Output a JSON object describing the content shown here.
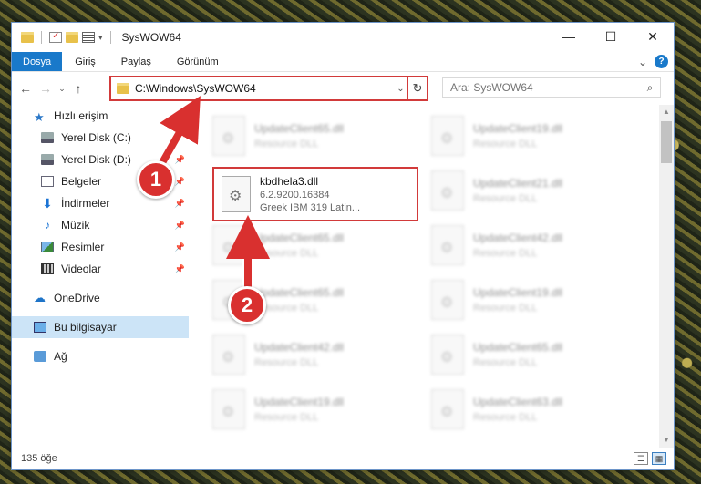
{
  "window": {
    "title": "SysWOW64",
    "controls": {
      "minimize": "—",
      "maximize": "☐",
      "close": "✕"
    }
  },
  "ribbon": {
    "tabs": [
      "Dosya",
      "Giriş",
      "Paylaş",
      "Görünüm"
    ],
    "expand": "⌄",
    "help": "?"
  },
  "nav": {
    "back": "←",
    "forward": "→",
    "recent": "⌄",
    "up": "↑"
  },
  "address": {
    "path": "C:\\Windows\\SysWOW64",
    "dropdown": "⌄",
    "refresh": "↻"
  },
  "search": {
    "placeholder": "Ara: SysWOW64",
    "icon": "search-icon"
  },
  "sidebar": {
    "quick_access": "Hızlı erişim",
    "items": [
      {
        "label": "Yerel Disk (C:)",
        "icon": "disk-icon",
        "pinned": true
      },
      {
        "label": "Yerel Disk (D:)",
        "icon": "disk-icon",
        "pinned": true
      },
      {
        "label": "Belgeler",
        "icon": "document-icon",
        "pinned": true
      },
      {
        "label": "İndirmeler",
        "icon": "download-icon",
        "pinned": true
      },
      {
        "label": "Müzik",
        "icon": "music-icon",
        "pinned": true
      },
      {
        "label": "Resimler",
        "icon": "pictures-icon",
        "pinned": true
      },
      {
        "label": "Videolar",
        "icon": "videos-icon",
        "pinned": true
      }
    ],
    "onedrive": "OneDrive",
    "this_pc": "Bu bilgisayar",
    "network": "Ağ"
  },
  "files": {
    "blurred": [
      {
        "name": "UpdateClient65.dll",
        "desc": "Resource DLL"
      },
      {
        "name": "UpdateClient19.dll",
        "desc": "Resource DLL"
      },
      {
        "name": "UpdateClient21.dll",
        "desc": "Resource DLL"
      },
      {
        "name": "UpdateClient65.dll",
        "desc": "Resource DLL"
      },
      {
        "name": "UpdateClient42.dll",
        "desc": "Resource DLL"
      },
      {
        "name": "UpdateClient65.dll",
        "desc": "Resource DLL"
      },
      {
        "name": "UpdateClient19.dll",
        "desc": "Resource DLL"
      },
      {
        "name": "UpdateClient42.dll",
        "desc": "Resource DLL"
      },
      {
        "name": "UpdateClient65.dll",
        "desc": "Resource DLL"
      },
      {
        "name": "UpdateClient19.dll",
        "desc": "Resource DLL"
      },
      {
        "name": "UpdateClient63.dll",
        "desc": "Resource DLL"
      }
    ],
    "featured": {
      "name": "kbdhela3.dll",
      "version": "6.2.9200.16384",
      "description": "Greek IBM 319 Latin..."
    }
  },
  "status": {
    "count": "135 öğe"
  },
  "annotations": {
    "step1": "1",
    "step2": "2",
    "color": "#d9302f"
  }
}
